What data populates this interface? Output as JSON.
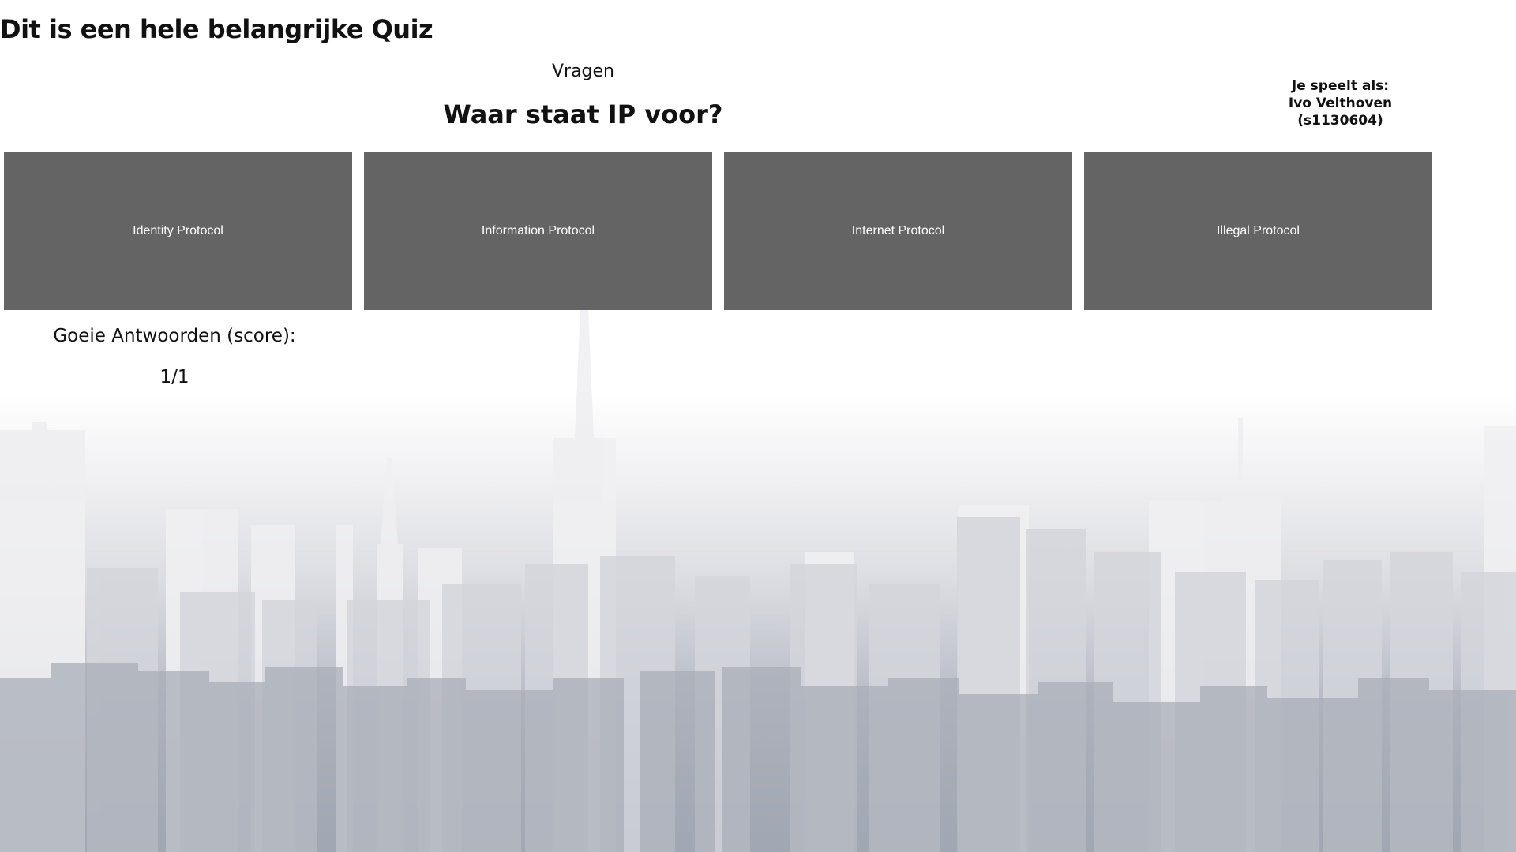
{
  "page": {
    "title": "Dit is een hele belangrijke Quiz"
  },
  "quiz": {
    "section_heading": "Vragen",
    "question": "Waar staat IP voor?",
    "answers": [
      {
        "label": "Identity Protocol"
      },
      {
        "label": "Information Protocol"
      },
      {
        "label": "Internet Protocol"
      },
      {
        "label": "Illegal Protocol"
      }
    ]
  },
  "player": {
    "line1": "Je speelt als:",
    "line2": "Ivo Velthoven",
    "line3": "(s1130604)"
  },
  "score": {
    "label": "Goeie Antwoorden (score):",
    "value": "1/1"
  },
  "colors": {
    "answer_background": "#646464",
    "answer_text": "#ffffff",
    "skyline_far": "#eeeef1",
    "skyline_mid": "#cfd1d8",
    "skyline_near": "#a4a9b4"
  },
  "icons": {
    "background": "city-skyline-illustration"
  }
}
